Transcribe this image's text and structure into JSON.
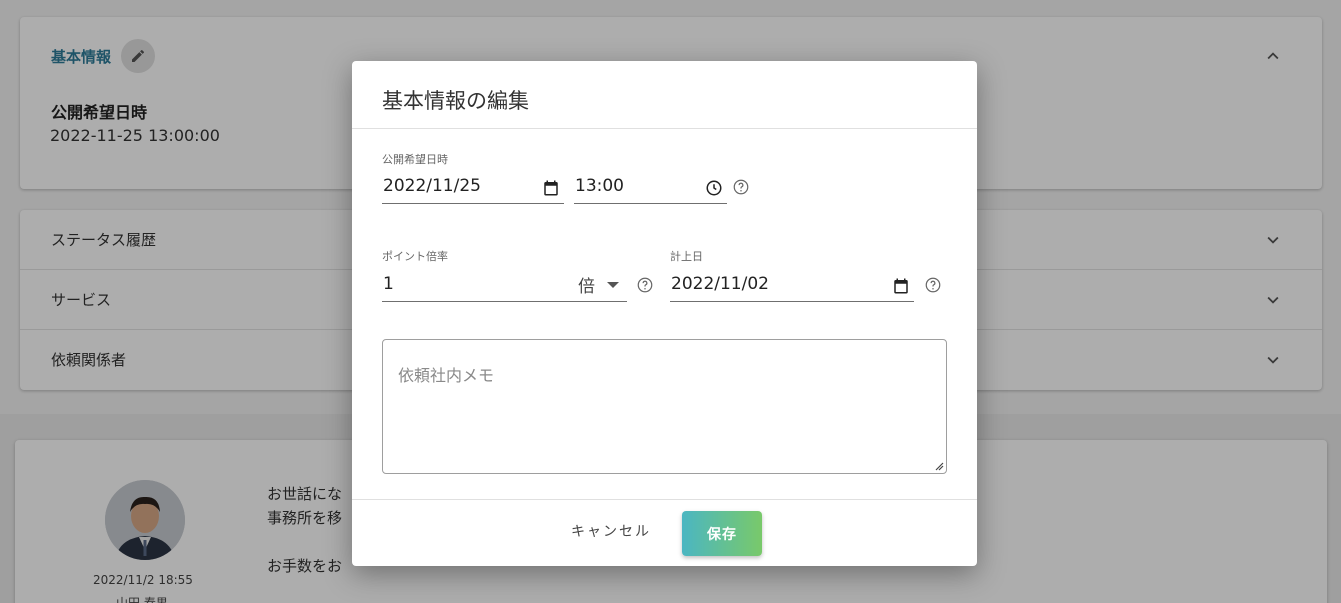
{
  "background": {
    "basic_card": {
      "title": "基本情報",
      "field_label": "公開希望日時",
      "field_value": "2022-11-25 13:00:00"
    },
    "accordion": [
      {
        "label": "ステータス履歴"
      },
      {
        "label": "サービス"
      },
      {
        "label": "依頼関係者"
      }
    ],
    "message": {
      "date": "2022/11/2 18:55",
      "author": "山田 春男",
      "text": "お世話にな\n事務所を移\n\nお手数をお"
    }
  },
  "dialog": {
    "title": "基本情報の編集",
    "publish": {
      "label": "公開希望日時",
      "date": "2022/11/25",
      "time": "13:00"
    },
    "point": {
      "label": "ポイント倍率",
      "value": "1",
      "unit": "倍"
    },
    "accounting": {
      "label": "計上日",
      "date": "2022/11/02"
    },
    "memo": {
      "placeholder": "依頼社内メモ",
      "value": ""
    },
    "buttons": {
      "cancel": "キャンセル",
      "save": "保存"
    }
  },
  "colors": {
    "accent_text": "#2f7d9a",
    "save_gradient_start": "#4bb6c2",
    "save_gradient_end": "#79c96a"
  },
  "icons": {
    "edit": "pencil-icon",
    "collapse": "chevron-up-icon",
    "expand": "chevron-down-icon",
    "calendar": "calendar-icon",
    "clock": "clock-icon",
    "help": "help-circle-icon",
    "dropdown": "caret-down-icon"
  }
}
